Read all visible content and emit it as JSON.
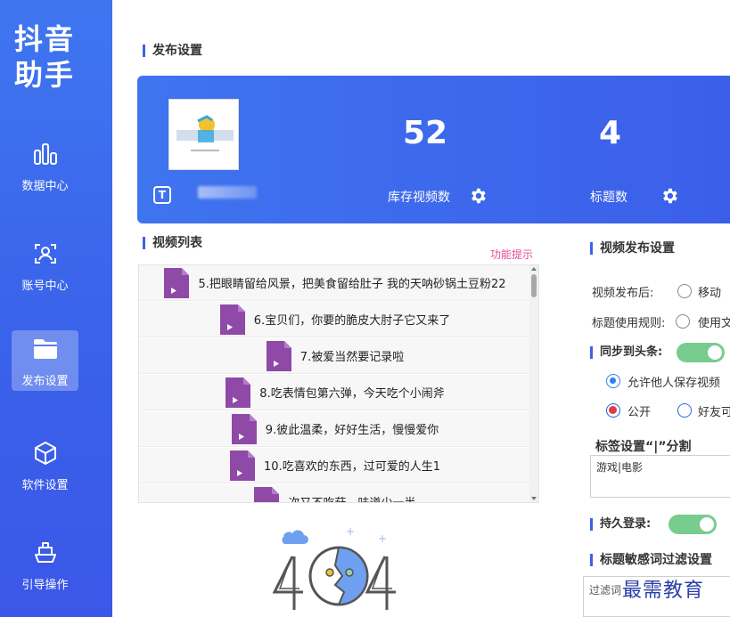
{
  "sidebar": {
    "brand": "抖音\n助手",
    "brand_line1": "抖音",
    "brand_line2": "助手",
    "items": [
      {
        "label": "数据中心",
        "icon": "bar-chart-icon"
      },
      {
        "label": "账号中心",
        "icon": "user-scan-icon"
      },
      {
        "label": "发布设置",
        "icon": "folder-icon",
        "active": true
      },
      {
        "label": "软件设置",
        "icon": "cube-icon"
      },
      {
        "label": "引导操作",
        "icon": "ship-icon"
      }
    ]
  },
  "publish": {
    "title": "发布设置",
    "stock_count": "52",
    "stock_label": "库存视频数",
    "title_count": "4",
    "title_label": "标题数"
  },
  "video_list": {
    "title": "视频列表",
    "hint": "功能提示",
    "items": [
      "5.把眼睛留给风景，把美食留给肚子 我的天呐砂锅土豆粉22",
      "6.宝贝们，你要的脆皮大肘子它又来了",
      "7.被爱当然要记录啦",
      "8.吃表情包第六弹，今天吃个小闹斧",
      "9.彼此温柔，好好生活，慢慢爱你",
      "10.吃喜欢的东西，过可爱的人生1",
      "次又不吃菇，味道少一半"
    ]
  },
  "publish_settings": {
    "title": "视频发布设置",
    "after_publish_label": "视频发布后:",
    "after_publish_option": "移动",
    "title_rule_label": "标题使用规则:",
    "title_rule_option": "使用文",
    "sync_label": "同步到头条:",
    "allow_save_label": "允许他人保存视频",
    "public_label": "公开",
    "friends_label": "好友可",
    "tag_label": "标签设置“|”分割",
    "tag_value": "游戏|电影",
    "persist_login_label": "持久登录:",
    "filter_title": "标题敏感词过滤设置",
    "filter_value": "过滤词"
  },
  "watermark": "最需教育",
  "colors": {
    "sidebar": "#3a62ea",
    "accent": "#3a62ea",
    "toggle_on": "#78cc8e",
    "hint": "#e24fa0",
    "file_icon": "#8e4aa6"
  }
}
